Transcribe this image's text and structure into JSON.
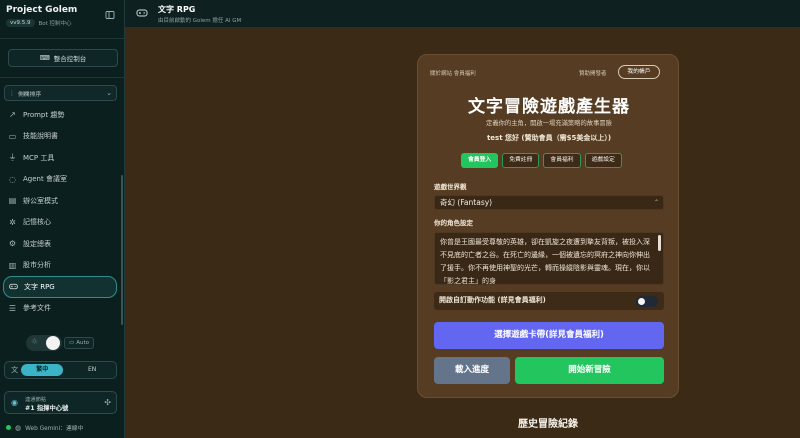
{
  "sidebar": {
    "brand": "Project Golem",
    "version": "vv9.5.9",
    "version_sub": "Bot 控制中心",
    "console_button": "整合控制台",
    "sort_label": "側欄排序",
    "items": [
      {
        "label": "Prompt 趨勢",
        "icon": "trend-icon"
      },
      {
        "label": "技能說明書",
        "icon": "book-icon"
      },
      {
        "label": "MCP 工具",
        "icon": "plug-icon"
      },
      {
        "label": "Agent 會議室",
        "icon": "chat-icon"
      },
      {
        "label": "辦公室模式",
        "icon": "office-icon"
      },
      {
        "label": "記憶核心",
        "icon": "brain-icon"
      },
      {
        "label": "設定總表",
        "icon": "gear-icon"
      },
      {
        "label": "股市分析",
        "icon": "chart-icon"
      },
      {
        "label": "文字 RPG",
        "icon": "gamepad-icon",
        "active": true
      },
      {
        "label": "參考文件",
        "icon": "database-icon"
      }
    ],
    "theme_auto": "Auto",
    "lang_zh": "繁中",
    "lang_en": "EN",
    "hq_label": "連通節點",
    "hq_value": "#1 指揮中心號",
    "status": "Web Gemini：連線中"
  },
  "header": {
    "title": "文字 RPG",
    "subtitle": "由目前啟動的 Golem 擔任 AI GM"
  },
  "card": {
    "top_links": "關於網站  會員福利",
    "sponsor": "贊助開發者",
    "account": "我的帳戶",
    "title": "文字冒險遊戲產生器",
    "subtitle": "定義你的主角，開啟一場充滿策略的故事冒險",
    "greeting": "test 您好 (贊助會員（需$5美金以上）)",
    "tabs": [
      "會員登入",
      "免費註冊",
      "會員福利",
      "遊戲設定"
    ],
    "world_label": "遊戲世界觀",
    "world_value": "奇幻 (Fantasy)",
    "role_label": "你的角色設定",
    "role_text": "你曾是王國最受尊敬的英雄，卻在凱旋之夜遭到摯友背叛，被投入深不見底的亡者之谷。在死亡的邊緣，一個被遺忘的冥府之神向你伸出了援手。你不再使用神聖的光芒，轉而操縱陰影與靈魂。現在，你以「影之君主」的身",
    "auto_label": "開啟自訂動作功能 (詳見會員福利)",
    "deck_button": "選擇遊戲卡帶(詳見會員福利)",
    "load_button": "載入進度",
    "new_button": "開始新冒險"
  },
  "history_title": "歷史冒險紀錄",
  "colors": {
    "accent_green": "#22c55e",
    "accent_indigo": "#6366f1",
    "slate": "#64748b",
    "card_bg": "#553c22",
    "page_bg": "#3b2a16"
  }
}
